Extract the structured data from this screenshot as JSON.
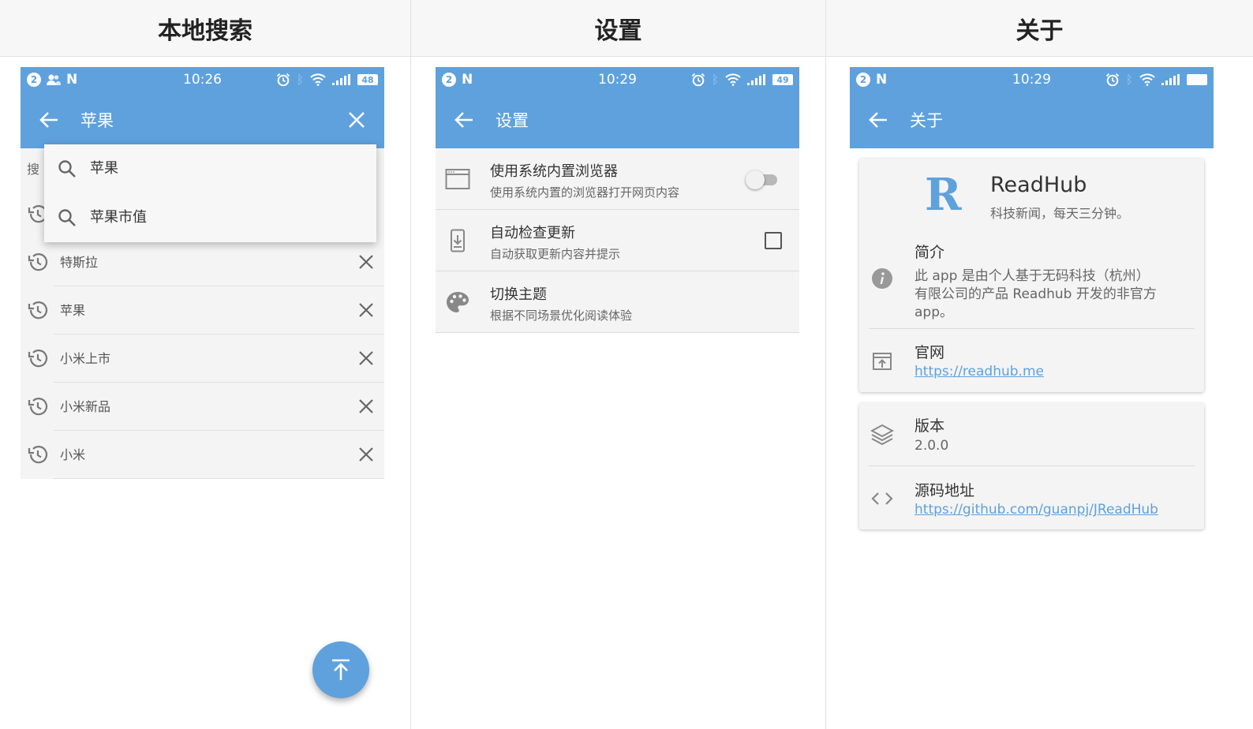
{
  "panels": [
    {
      "caption": "本地搜索",
      "status": {
        "time": "10:26",
        "notif_count": "2",
        "battery": "48"
      },
      "appbar_title": "苹果",
      "hidden_header": "搜",
      "suggestions": [
        "苹果",
        "苹果市值"
      ],
      "history": [
        "特斯拉",
        "苹果",
        "小米上市",
        "小米新品",
        "小米"
      ]
    },
    {
      "caption": "设置",
      "status": {
        "time": "10:29",
        "notif_count": "2",
        "battery": "49"
      },
      "appbar_title": "设置",
      "settings": [
        {
          "title": "使用系统内置浏览器",
          "subtitle": "使用系统内置的浏览器打开网页内容",
          "control": "toggle",
          "value": false
        },
        {
          "title": "自动检查更新",
          "subtitle": "自动获取更新内容并提示",
          "control": "checkbox",
          "value": false
        },
        {
          "title": "切换主题",
          "subtitle": "根据不同场景优化阅读体验",
          "control": "none"
        }
      ]
    },
    {
      "caption": "关于",
      "status": {
        "time": "10:29",
        "notif_count": "2"
      },
      "appbar_title": "关于",
      "app": {
        "logo_letter": "R",
        "name": "ReadHub",
        "tagline": "科技新闻，每天三分钟。"
      },
      "intro": {
        "label": "简介",
        "lines": [
          "此 app 是由个人基于无码科技（杭州）",
          "有限公司的产品 Readhub 开发的非官方",
          "app。"
        ]
      },
      "website": {
        "label": "官网",
        "url": "https://readhub.me"
      },
      "version": {
        "label": "版本",
        "value": "2.0.0"
      },
      "source": {
        "label": "源码地址",
        "url": "https://github.com/guanpj/JReadHub"
      }
    }
  ],
  "colors": {
    "primary": "#5ea1dd",
    "row_bg": "#f4f4f4",
    "divider": "#dcdcdc"
  }
}
